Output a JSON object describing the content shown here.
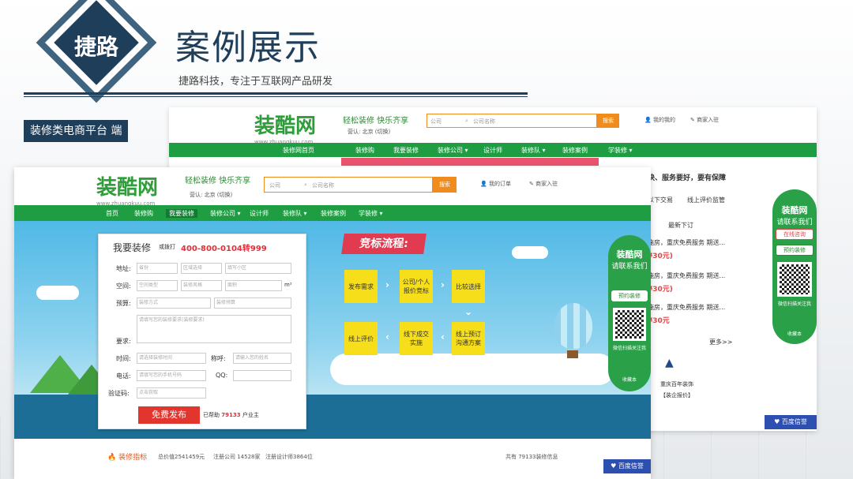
{
  "slide": {
    "logo_text": "捷路",
    "title": "案例展示",
    "subtitle": "捷路科技，专注于互联网产品研发",
    "tag": "装修类电商平台   端"
  },
  "back_page": {
    "logo": "装酷网",
    "logo_url": "www.zhuangkuu.com",
    "slogan": "轻松装修 快乐齐享",
    "city": "营认: 北京 (切换)",
    "search_type": "公司",
    "search_placeholder": "公司名称",
    "search_button": "搜索",
    "link_orders": "我的我的",
    "link_apply": "商家入驻",
    "nav": [
      "装修网首页",
      "装修购",
      "我要装修",
      "装修公司 ▾",
      "设计师",
      "装修队 ▾",
      "装修案例",
      "学装修 ▾"
    ],
    "side": {
      "headline": "快、服务要好，要有保障",
      "tabs": [
        "以下交易",
        "线上评价监管"
      ],
      "subhead": "最新下订",
      "items": [
        "施房，重庆免费服务 期送...",
        "施房，重庆免费服务 期送...",
        "施房，重庆免费服务 期送..."
      ],
      "prices": [
        "¥30元)",
        "¥30元)",
        "¥30元"
      ],
      "more": "更多>>",
      "brand": "重庆百年装饰",
      "brand_link": "【装企报价】"
    },
    "qr": {
      "logo": "装酷网",
      "slogan": "请联系我们",
      "btn1": "在线咨询",
      "btn2": "预约装修",
      "caption": "微信扫描关注我",
      "bottom": "收藏本"
    },
    "blue_button": "百度信誉"
  },
  "front_page": {
    "logo": "装酷网",
    "logo_url": "www.zhuangkuu.com",
    "slogan": "轻松装修 快乐齐享",
    "city": "营认: 北京 (切换)",
    "search_type": "公司",
    "search_placeholder": "公司名称",
    "search_button": "搜索",
    "link_orders": "我的订单",
    "link_apply": "商家入驻",
    "nav": [
      "首页",
      "装修购",
      "我要装修",
      "装修公司 ▾",
      "设计师",
      "装修队 ▾",
      "装修案例",
      "学装修 ▾"
    ],
    "process_title": "竞标流程:",
    "steps": [
      "发布需求",
      "公司/个人报价竞标",
      "比较选择",
      "线上预订沟通方案",
      "线下成交实施",
      "线上评价"
    ],
    "form": {
      "title": "我要装修",
      "hotline_label": "或拨打",
      "hotline": "400-800-0104转999",
      "address_label": "地址:",
      "province": "省份",
      "district": "区域选择",
      "community": "填写小区",
      "space_label": "空间:",
      "type": "空间类型",
      "style": "装修风格",
      "area_ph": "面积",
      "area_unit": "m²",
      "budget_label": "预算:",
      "mode": "装修方式",
      "budget": "装修预算",
      "req_label": "要求:",
      "req_ph": "请填写您的装修要求(装修要求)",
      "time_label": "时间:",
      "time_ph": "请选择装修时间",
      "name_label": "称呼:",
      "name_ph": "请输入您的姓名",
      "phone_label": "电话:",
      "phone_ph": "请填写您的手机号码",
      "qq_label": "QQ:",
      "captcha_label": "验证码:",
      "captcha_ph": "点击获取",
      "publish": "免费发布",
      "count_pre": "已帮助",
      "count": "79133",
      "count_post": "户业主"
    },
    "qr": {
      "logo": "装酷网",
      "slogan": "请联系我们",
      "btn": "预约装修",
      "caption": "微信扫描关注我",
      "bottom": "收藏本"
    },
    "bottom": {
      "label": "装修指标",
      "stat1": "总价值2541459元",
      "stat2": "注册公司 14528家",
      "stat3": "注册设计师3864位",
      "total": "共有 79133装修信息"
    },
    "blue_button": "百度信誉"
  },
  "colors": {
    "navy": "#1e3e5a",
    "green": "#1f9d43",
    "orange": "#f08c1e",
    "red": "#e1352e"
  }
}
